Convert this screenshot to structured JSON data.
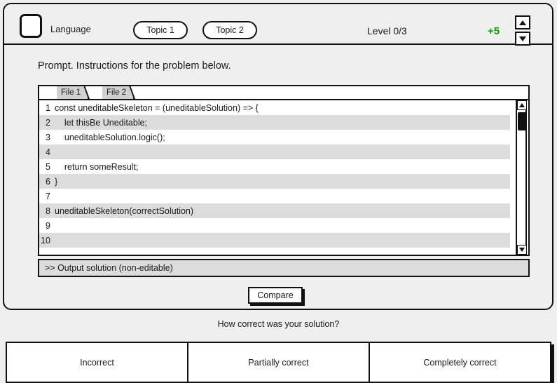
{
  "topbar": {
    "language_label": "Language",
    "language_selector_icon": "rounded-square-checkbox",
    "topic_buttons": [
      {
        "label": "Topic 1"
      },
      {
        "label": "Topic 2"
      }
    ],
    "level_text": "Level 0/3",
    "score_text": "+5",
    "score_color": "#00a000",
    "stepper": {
      "up_icon": "triangle-up-icon",
      "down_icon": "triangle-down-icon"
    }
  },
  "prompt": {
    "text": "Prompt.  Instructions for the problem below."
  },
  "editor": {
    "tabs": [
      {
        "label": "File 1",
        "active": true
      },
      {
        "label": "File 2",
        "active": false
      }
    ],
    "lines": [
      {
        "num": "1",
        "text": "const uneditableSkeleton = (uneditableSolution) => {"
      },
      {
        "num": "2",
        "text": "    let thisBe Uneditable;"
      },
      {
        "num": "3",
        "text": "    uneditableSolution.logic();"
      },
      {
        "num": "4",
        "text": ""
      },
      {
        "num": "5",
        "text": "    return someResult;"
      },
      {
        "num": "6",
        "text": "}"
      },
      {
        "num": "7",
        "text": ""
      },
      {
        "num": "8",
        "text": "uneditableSkeleton(correctSolution)"
      },
      {
        "num": "9",
        "text": ""
      },
      {
        "num": "10",
        "text": ""
      }
    ],
    "scrollbar": {
      "up_icon": "scroll-up-arrow-icon",
      "down_icon": "scroll-down-arrow-icon"
    },
    "output_text": ">> Output solution (non-editable)"
  },
  "compare_button": {
    "label": "Compare"
  },
  "feedback": {
    "question": "How correct was your solution?",
    "options": [
      {
        "label": "Incorrect"
      },
      {
        "label": "Partially correct"
      },
      {
        "label": "Completely correct"
      }
    ]
  }
}
